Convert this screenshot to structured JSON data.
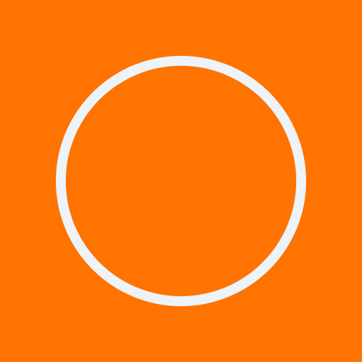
{
  "scene": {
    "background_color": "#FF7300",
    "ring": {
      "icon": "circle-outline-icon",
      "stroke_color": "#EEF3FA",
      "fill": "none"
    }
  }
}
